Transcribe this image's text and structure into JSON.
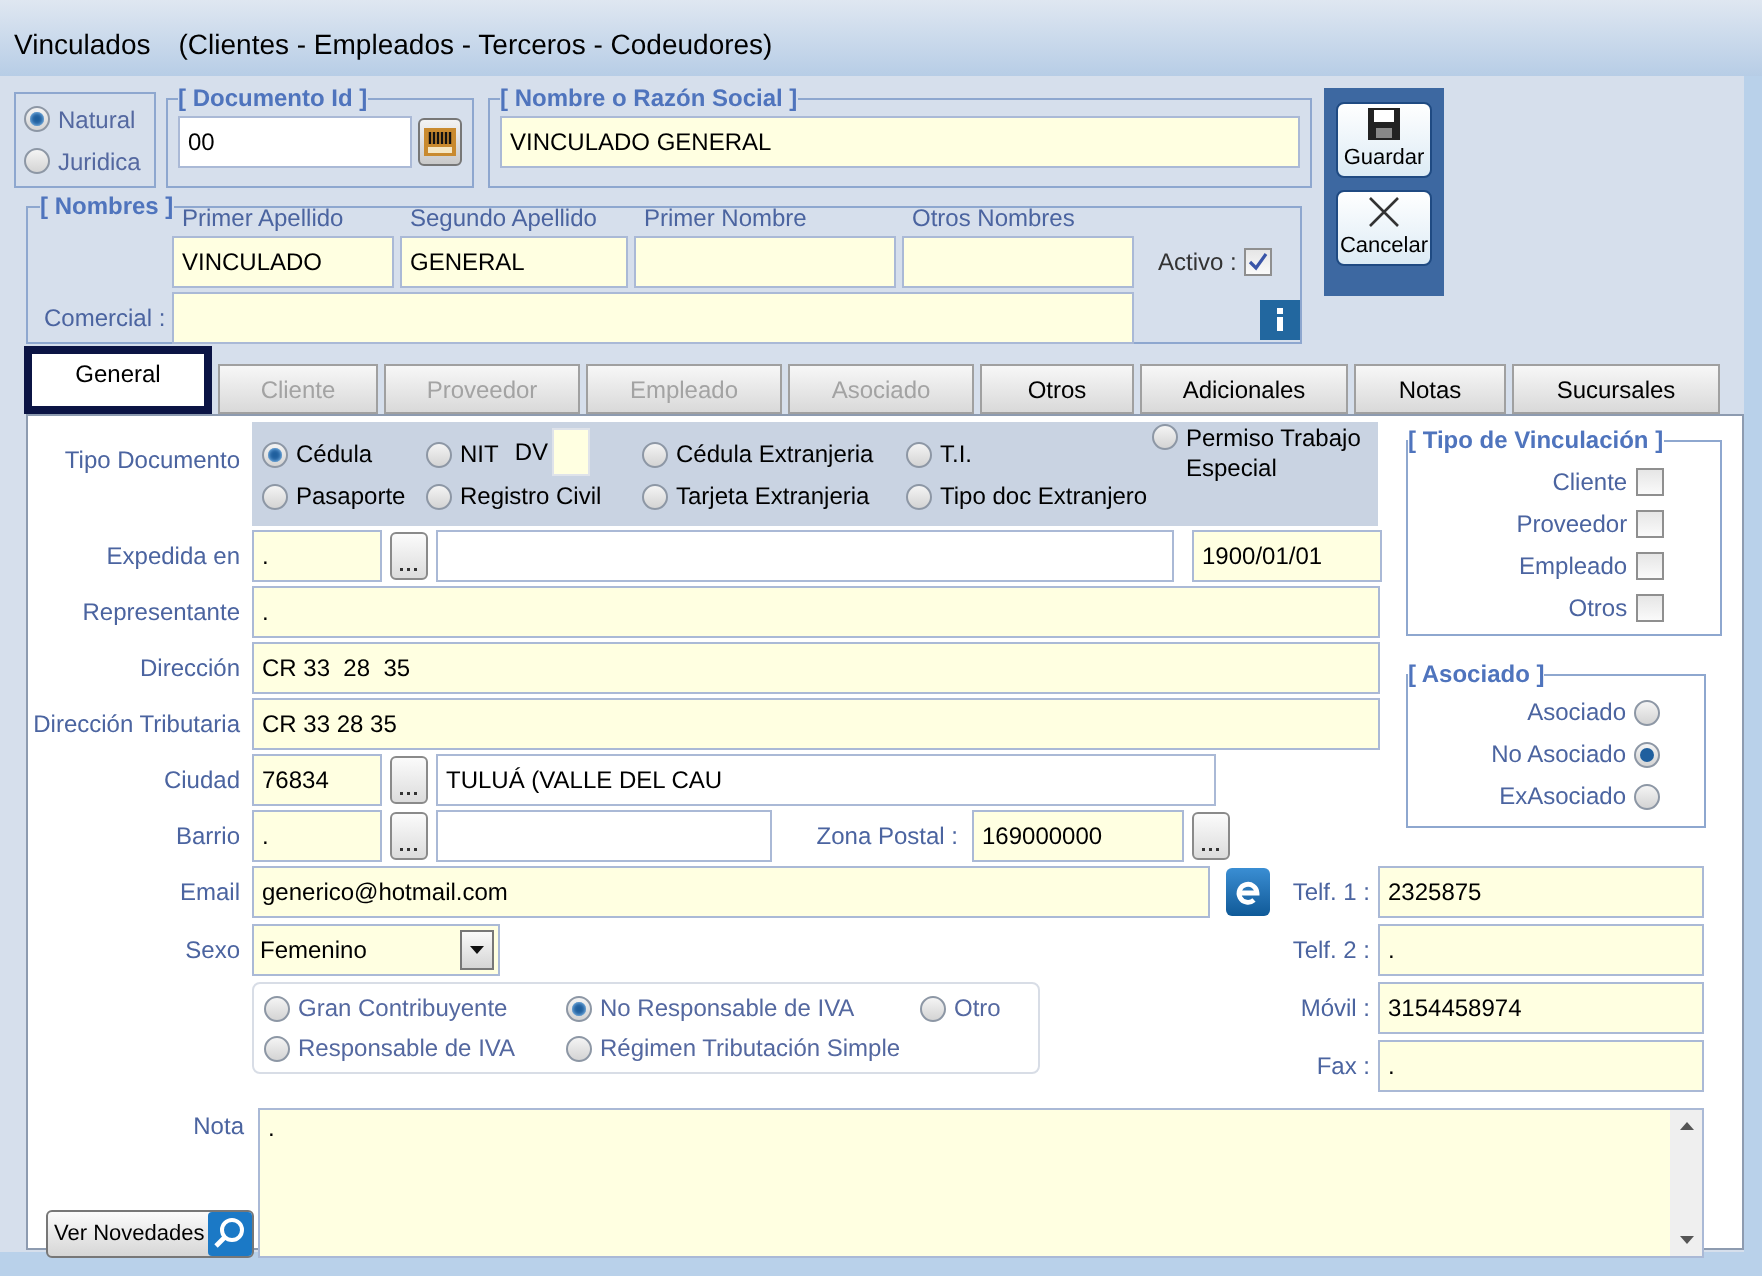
{
  "window": {
    "title": "Vinculados",
    "subtitle": "(Clientes - Empleados - Terceros - Codeudores)"
  },
  "persona": [
    {
      "label": "Natural",
      "selected": true
    },
    {
      "label": "Juridica",
      "selected": false
    }
  ],
  "documento_id": {
    "legend": "[ Documento Id ]",
    "value": "00"
  },
  "razon_social": {
    "legend": "[ Nombre o Razón Social ]",
    "value": "VINCULADO GENERAL"
  },
  "actions": [
    {
      "kind": "save",
      "label": "Guardar"
    },
    {
      "kind": "cancel",
      "label": "Cancelar"
    }
  ],
  "nombres": {
    "legend": "[ Nombres ]",
    "fields": [
      {
        "label": "Primer Apellido",
        "value": "VINCULADO"
      },
      {
        "label": "Segundo Apellido",
        "value": "GENERAL"
      },
      {
        "label": "Primer Nombre"
      },
      {
        "label": "Otros Nombres"
      }
    ],
    "activo": {
      "label": "Activo :",
      "checked": true
    },
    "comercial_label": "Comercial :"
  },
  "tabs": [
    {
      "label": "General",
      "selected": true,
      "disabled": false
    },
    {
      "label": "Cliente",
      "selected": false,
      "disabled": true
    },
    {
      "label": "Proveedor",
      "selected": false,
      "disabled": true
    },
    {
      "label": "Empleado",
      "selected": false,
      "disabled": true
    },
    {
      "label": "Asociado",
      "selected": false,
      "disabled": true
    },
    {
      "label": "Otros",
      "selected": false,
      "disabled": false
    },
    {
      "label": "Adicionales",
      "selected": false,
      "disabled": false
    },
    {
      "label": "Notas",
      "selected": false,
      "disabled": false
    },
    {
      "label": "Sucursales",
      "selected": false,
      "disabled": false
    }
  ],
  "tipo_documento": {
    "label": "Tipo Documento",
    "columns": [
      [
        {
          "label": "Cédula",
          "selected": true
        },
        {
          "label": "Pasaporte",
          "selected": false
        }
      ],
      [
        {
          "label": "NIT",
          "selected": false,
          "dv_label": "DV"
        },
        {
          "label": "Registro Civil",
          "selected": false
        }
      ],
      [
        {
          "label": "Cédula Extranjeria",
          "selected": false
        },
        {
          "label": "Tarjeta Extranjeria",
          "selected": false
        }
      ],
      [
        {
          "label": "T.I.",
          "selected": false
        },
        {
          "label": "Tipo doc Extranjero",
          "selected": false
        }
      ],
      [
        {
          "label": "Permiso Trabajo Especial",
          "selected": false
        }
      ]
    ]
  },
  "expedida": {
    "label": "Expedida en",
    "code": ".",
    "date": "1900/01/01"
  },
  "representante": {
    "label": "Representante",
    "value": "."
  },
  "direccion": {
    "label": "Dirección",
    "value": "CR 33  28  35"
  },
  "direccion_tributaria": {
    "label": "Dirección Tributaria",
    "value": "CR 33 28 35"
  },
  "ciudad": {
    "label": "Ciudad",
    "code": "76834",
    "name": "TULUÁ (VALLE DEL CAU"
  },
  "barrio": {
    "label": "Barrio",
    "code": ".",
    "zona_label": "Zona Postal :",
    "zona": "169000000"
  },
  "email": {
    "label": "Email",
    "value": "generico@hotmail.com"
  },
  "sexo": {
    "label": "Sexo",
    "value": "Femenino"
  },
  "regimen": [
    [
      {
        "label": "Gran Contribuyente",
        "selected": false
      },
      {
        "label": "Responsable de IVA",
        "selected": false
      }
    ],
    [
      {
        "label": "No Responsable de IVA",
        "selected": true
      },
      {
        "label": "Régimen Tributación Simple",
        "selected": false
      }
    ],
    [
      {
        "label": "Otro",
        "selected": false
      }
    ]
  ],
  "telefonos": [
    {
      "label": "Telf. 1 :",
      "value": "2325875"
    },
    {
      "label": "Telf. 2 :",
      "value": "."
    },
    {
      "label": "Móvil :",
      "value": "3154458974"
    },
    {
      "label": "Fax :",
      "value": "."
    }
  ],
  "nota": {
    "label": "Nota",
    "value": "."
  },
  "ver_novedades": "Ver Novedades",
  "tipo_vinculacion": {
    "legend": "[ Tipo de Vinculación ]",
    "items": [
      {
        "label": "Cliente",
        "checked": false
      },
      {
        "label": "Proveedor",
        "checked": false
      },
      {
        "label": "Empleado",
        "checked": false
      },
      {
        "label": "Otros",
        "checked": false
      }
    ]
  },
  "asociado": {
    "legend": "[ Asociado ]",
    "items": [
      {
        "label": "Asociado",
        "selected": false
      },
      {
        "label": "No Asociado",
        "selected": true
      },
      {
        "label": "ExAsociado",
        "selected": false
      }
    ]
  }
}
